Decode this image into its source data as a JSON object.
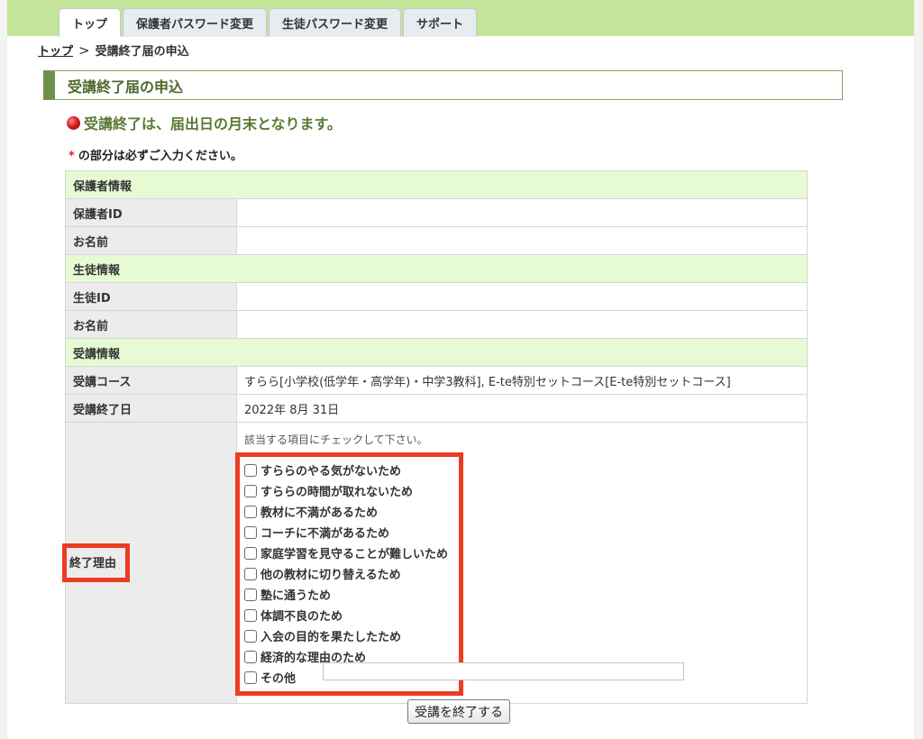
{
  "tabs": [
    {
      "label": "トップ",
      "active": true
    },
    {
      "label": "保護者パスワード変更",
      "active": false
    },
    {
      "label": "生徒パスワード変更",
      "active": false
    },
    {
      "label": "サポート",
      "active": false
    }
  ],
  "breadcrumb": {
    "home": "トップ",
    "separator": ">",
    "current": "受講終了届の申込"
  },
  "section_title": "受講終了届の申込",
  "notice": "受講終了は、届出日の月末となります。",
  "required_note": {
    "mark": "*",
    "text": "の部分は必ずご入力ください。"
  },
  "form": {
    "guardian_group": "保護者情報",
    "guardian_id_label": "保護者ID",
    "guardian_name_label": "お名前",
    "student_group": "生徒情報",
    "student_id_label": "生徒ID",
    "student_name_label": "お名前",
    "course_group": "受講情報",
    "course_label": "受講コース",
    "course_value": "すらら[小学校(低学年・高学年)・中学3教科], E-te特別セットコース[E-te特別セットコース]",
    "end_date_label": "受講終了日",
    "end_date_value": "2022年 8月 31日",
    "reason_label": "終了理由",
    "reason_instruction": "該当する項目にチェックして下さい。",
    "reasons": [
      "すららのやる気がないため",
      "すららの時間が取れないため",
      "教材に不満があるため",
      "コーチに不満があるため",
      "家庭学習を見守ることが難しいため",
      "他の教材に切り替えるため",
      "塾に通うため",
      "体調不良のため",
      "入会の目的を果たしたため",
      "経済的な理由のため",
      "その他"
    ]
  },
  "submit_label": "受講を終了する",
  "colors": {
    "accent": "#6f8f4c",
    "highlight": "#ec3c23",
    "group_bg": "#e6fbd3"
  }
}
